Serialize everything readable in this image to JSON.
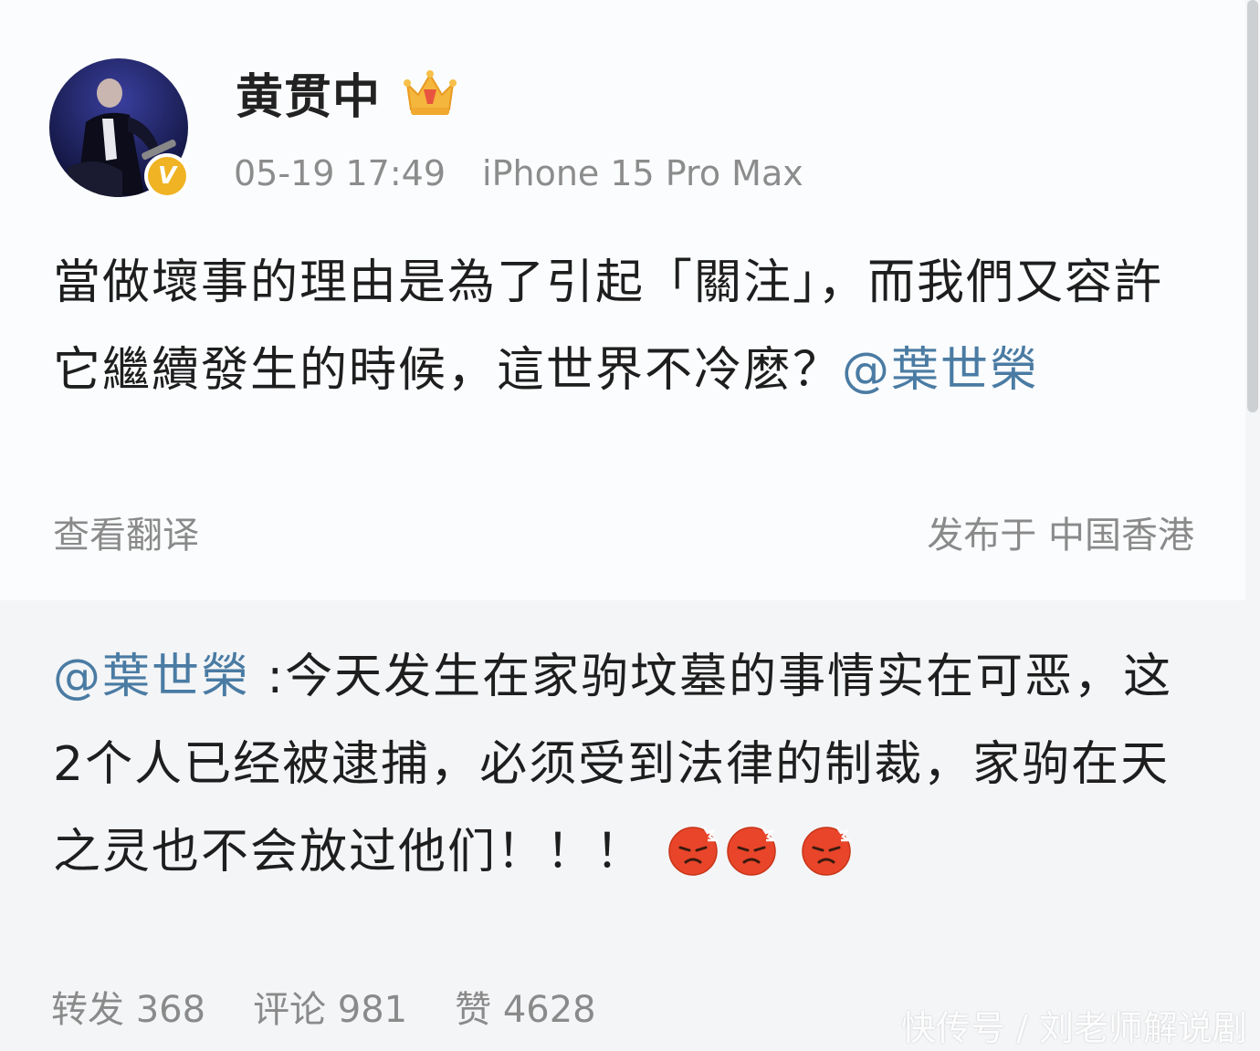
{
  "post": {
    "username": "黄贯中",
    "timestamp": "05-19 17:49",
    "device": "iPhone 15 Pro Max",
    "text_before_mention": "當做壞事的理由是為了引起「關注」，而我們又容許它繼續發生的時候，這世界不冷麽？",
    "mention": "@葉世榮",
    "translate_label": "查看翻译",
    "location": "发布于 中国香港",
    "badge_letter": "V"
  },
  "repost": {
    "mention": "@葉世榮",
    "text": " :今天发生在家驹坟墓的事情实在可恶，这2个人已经被逮捕，必须受到法律的制裁，家驹在天之灵也不会放过他们！！！",
    "emoji_count": 3,
    "stats": {
      "repost": "转发 368",
      "comment": "评论 981",
      "like": "赞 4628"
    }
  },
  "watermark": "快传号 / 刘老师解说剧",
  "icons": {
    "crown": "crown-icon",
    "verified": "verified-badge-icon",
    "emoji": "angry-face-emoji"
  },
  "colors": {
    "mention": "#4a7ba3",
    "meta": "#8c8c8c",
    "repost_bg": "#f4f5f7",
    "verified": "#f0b323"
  }
}
